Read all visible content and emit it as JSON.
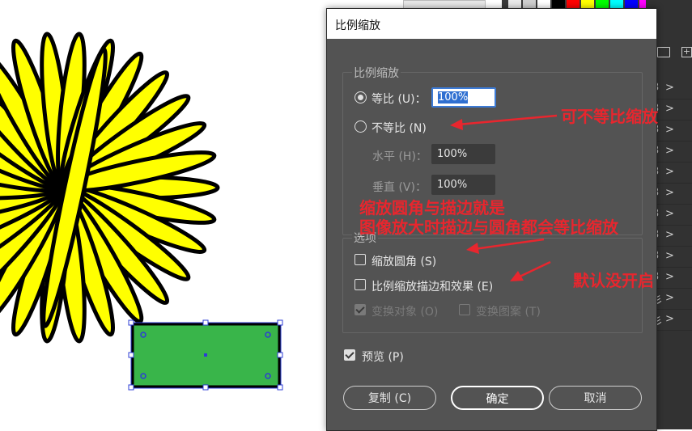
{
  "dialog": {
    "title": "比例缩放",
    "group_scale": {
      "legend": "比例缩放",
      "uniform_label": "等比 (U)：",
      "uniform_value": "100%",
      "nonuniform_label": "不等比 (N)",
      "horizontal_label": "水平 (H)：",
      "horizontal_value": "100%",
      "vertical_label": "垂直 (V)：",
      "vertical_value": "100%"
    },
    "group_options": {
      "legend": "选项",
      "scale_corners_label": "缩放圆角 (S)",
      "scale_strokes_label": "比例缩放描边和效果 (E)",
      "transform_objects_label": "变换对象 (O)",
      "transform_patterns_label": "变换图案 (T)"
    },
    "preview_label": "预览 (P)",
    "buttons": {
      "copy": "复制 (C)",
      "ok": "确定",
      "cancel": "取消"
    }
  },
  "annotations": {
    "nonuniform_note": "可不等比缩放",
    "options_note_line1": "缩放圆角与描边就是",
    "options_note_line2": "图像放大时描边与圆角都会等比缩放",
    "default_note": "默认没开启"
  },
  "right_panel": {
    "row_glyph": "3",
    "row_glyph_alt": "彡",
    "chevron": ">"
  },
  "colors": {
    "dialog_bg": "#535353",
    "flower_fill": "#ffff00",
    "rect_fill": "#39b54a",
    "annotation": "#e8262e",
    "selection": "#2d3cd6"
  }
}
